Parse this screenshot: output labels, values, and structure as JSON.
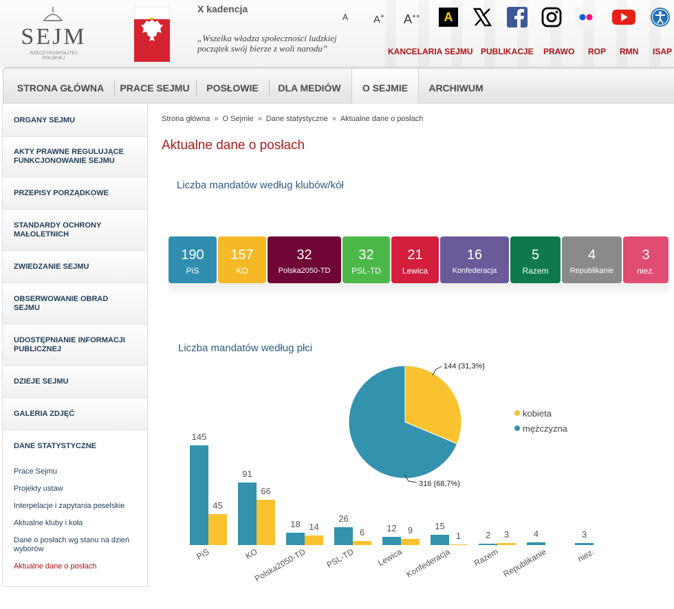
{
  "header": {
    "logo_text": "SEJM",
    "logo_subtitle": "RZECZYPOSPOLITEJ POLSKIEJ",
    "kadencja": "X kadencja",
    "quote_line1": "„Wszelka władza społeczności ludzkiej",
    "quote_line2": "początek swój bierze z woli narodu”",
    "accessibility": {
      "a_small": "A",
      "a_medium": "A",
      "a_medium_sup": "+",
      "a_large": "A",
      "a_large_sup": "++",
      "contrast": "A"
    },
    "social_icons": [
      "x-icon",
      "facebook-icon",
      "instagram-icon",
      "flickr-icon",
      "youtube-icon",
      "accessibility-icon"
    ],
    "top_links": [
      "KANCELARIA SEJMU",
      "PUBLIKACJE",
      "PRAWO",
      "ROP",
      "RMN",
      "ISAP"
    ]
  },
  "main_nav": {
    "items": [
      "STRONA GŁÓWNA",
      "PRACE SEJMU",
      "POSŁOWIE",
      "DLA MEDIÓW",
      "O SEJMIE",
      "ARCHIWUM"
    ],
    "active": "O SEJMIE"
  },
  "sidebar": {
    "items": [
      "ORGANY SEJMU",
      "AKTY PRAWNE REGULUJĄCE FUNKCJONOWANIE SEJMU",
      "PRZEPISY PORZĄDKOWE",
      "STANDARDY OCHRONY MAŁOLETNICH",
      "ZWIEDZANIE SEJMU",
      "OBSERWOWANIE OBRAD SEJMU",
      "UDOSTĘPNIANIE INFORMACJI PUBLICZNEJ",
      "DZIEJE SEJMU",
      "GALERIA ZDJĘĆ",
      "DANE STATYSTYCZNE"
    ],
    "sub_items": [
      "Prace Sejmu",
      "Projekty ustaw",
      "Interpelacje i zapytania poselskie",
      "Aktualne kluby i koła",
      "Dane o posłach wg stanu na dzień wyborów",
      "Aktualne dane o posłach"
    ],
    "active_sub": "Aktualne dane o posłach"
  },
  "breadcrumb": [
    "Strona główna",
    "O Sejmie",
    "Dane statystyczne",
    "Aktualne dane o posłach"
  ],
  "breadcrumb_sep": "»",
  "page_title": "Aktualne dane o posłach",
  "clubs_section_title": "Liczba mandatów według klubów/kół",
  "clubs": [
    {
      "name": "PiS",
      "count": "190",
      "color": "#2f8eb0"
    },
    {
      "name": "KO",
      "count": "157",
      "color": "#f5b927"
    },
    {
      "name": "Polska2050-TD",
      "count": "32",
      "color": "#6e0535"
    },
    {
      "name": "PSL-TD",
      "count": "32",
      "color": "#4cb848"
    },
    {
      "name": "Lewica",
      "count": "21",
      "color": "#d31f3b"
    },
    {
      "name": "Konfederacja",
      "count": "16",
      "color": "#6a5a9a"
    },
    {
      "name": "Razem",
      "count": "5",
      "color": "#0e7a4c"
    },
    {
      "name": "Republikanie",
      "count": "4",
      "color": "#8a8a8a"
    },
    {
      "name": "niez.",
      "count": "3",
      "color": "#e14c72"
    }
  ],
  "gender_section_title": "Liczba mandatów według płci",
  "colors": {
    "women": "#f9c22e",
    "men": "#3392ae",
    "accent_red": "#b01116",
    "link_blue": "#1f3d5a"
  },
  "chart_data": [
    {
      "type": "pie",
      "labels": [
        "kobieta",
        "mężczyzna"
      ],
      "values": [
        144,
        316
      ],
      "data_labels": [
        "144 (31,3%)",
        "316 (68,7%)"
      ],
      "legend": [
        "kobieta",
        "mężczyzna"
      ],
      "legend_position": "right"
    },
    {
      "type": "bar",
      "categories": [
        "PiS",
        "KO",
        "Polska2050-TD",
        "PSL-TD",
        "Lewica",
        "Konfederacja",
        "Razem",
        "Republikanie",
        "niez."
      ],
      "series": [
        {
          "name": "mężczyzna",
          "values": [
            145,
            91,
            18,
            26,
            12,
            15,
            2,
            4,
            3
          ]
        },
        {
          "name": "kobieta",
          "values": [
            45,
            66,
            14,
            6,
            9,
            1,
            3,
            0,
            0
          ]
        }
      ],
      "data_labels_shown": [
        [
          "145",
          "91",
          "18",
          "26",
          "12",
          "15",
          "2",
          "4",
          "3"
        ],
        [
          "45",
          "66",
          "14",
          "6",
          "9",
          "1",
          "3",
          "",
          ""
        ]
      ],
      "ylim": [
        0,
        150
      ]
    }
  ]
}
